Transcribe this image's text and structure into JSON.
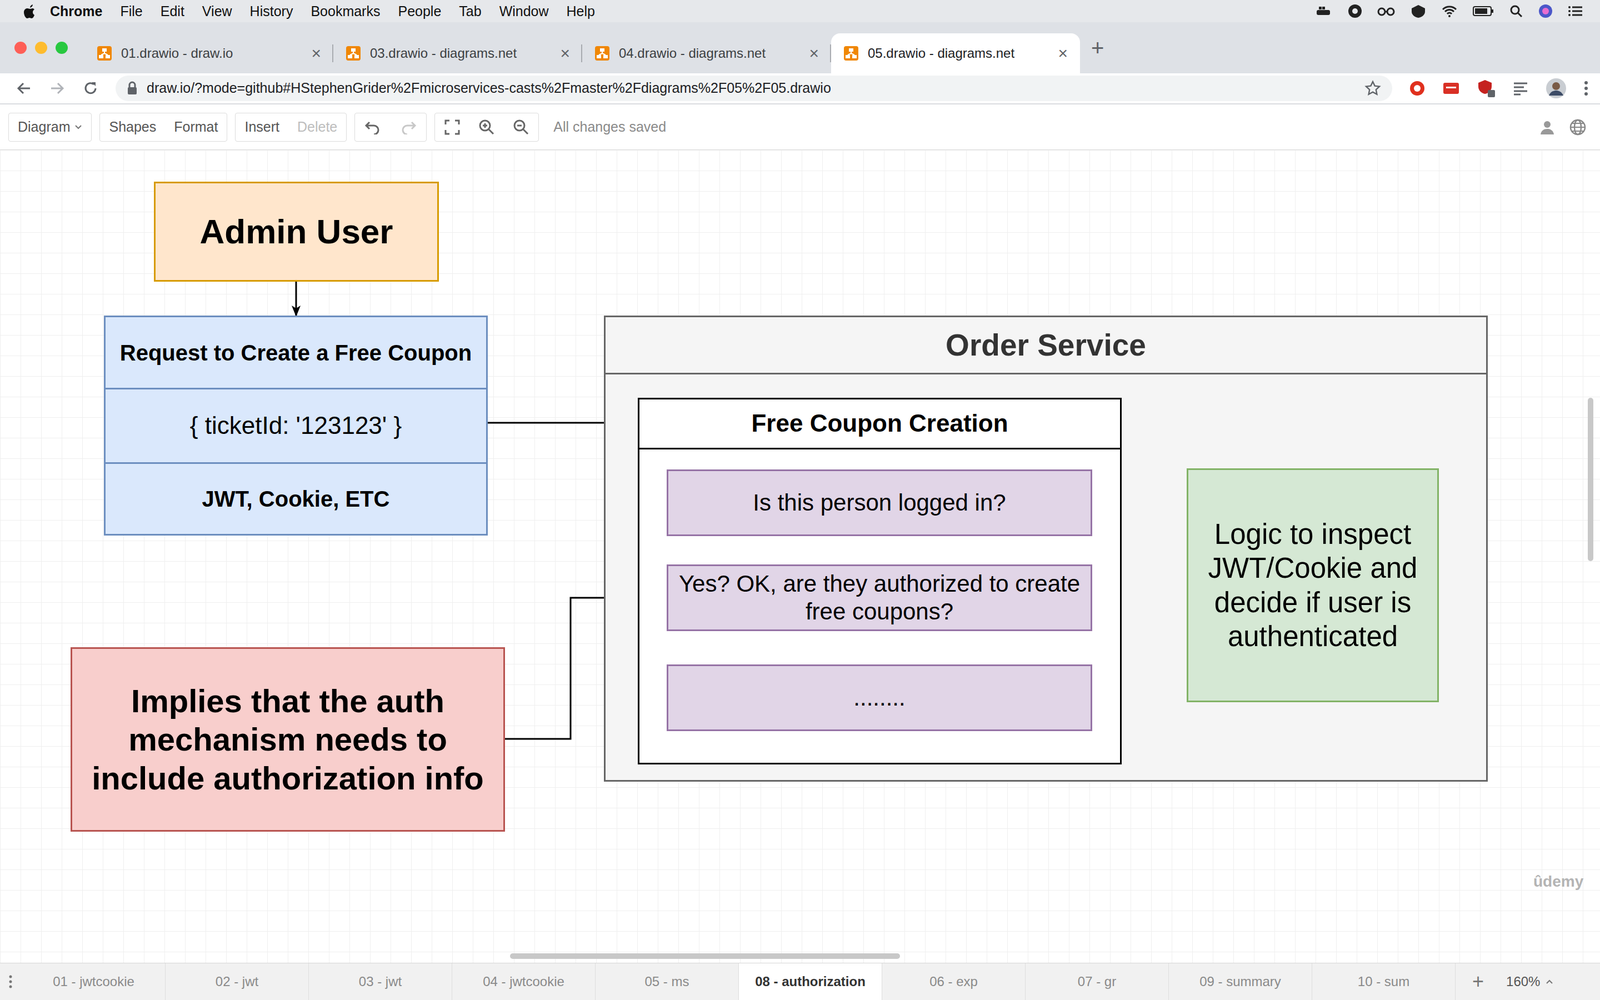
{
  "menubar": {
    "app": "Chrome",
    "items": [
      "File",
      "Edit",
      "View",
      "History",
      "Bookmarks",
      "People",
      "Tab",
      "Window",
      "Help"
    ]
  },
  "browser_tabs": [
    {
      "label": "01.drawio - draw.io",
      "close": "×",
      "selected": false
    },
    {
      "label": "03.drawio - diagrams.net",
      "close": "×",
      "selected": false
    },
    {
      "label": "04.drawio - diagrams.net",
      "close": "×",
      "selected": false
    },
    {
      "label": "05.drawio - diagrams.net",
      "close": "×",
      "selected": true
    }
  ],
  "new_tab": "+",
  "address": {
    "url": "draw.io/?mode=github#HStephenGrider%2Fmicroservices-casts%2Fmaster%2Fdiagrams%2F05%2F05.drawio"
  },
  "toolbar": {
    "groups": [
      [
        {
          "label": "Diagram",
          "kind": "dropdown",
          "disabled": false
        }
      ],
      [
        {
          "label": "Shapes",
          "kind": "button",
          "disabled": false
        },
        {
          "label": "Format",
          "kind": "button",
          "disabled": false
        }
      ],
      [
        {
          "label": "Insert",
          "kind": "button",
          "disabled": false
        },
        {
          "label": "Delete",
          "kind": "button",
          "disabled": true
        }
      ]
    ],
    "history_buttons": [
      {
        "kind": "undo",
        "disabled": false
      },
      {
        "kind": "redo",
        "disabled": true
      }
    ],
    "status": "All changes saved"
  },
  "diagram": {
    "admin_user": "Admin User",
    "request": {
      "title": "Request to Create a Free Coupon",
      "body": "{ ticketId: '123123' }",
      "auth": "JWT, Cookie, ETC"
    },
    "order_service": {
      "title": "Order Service",
      "free_coupon_creation": {
        "title": "Free Coupon Creation",
        "steps": [
          "Is this person logged in?",
          "Yes? OK, are they authorized to create free coupons?",
          "........"
        ]
      }
    },
    "logic_note": "Logic to inspect JWT/Cookie and decide if user is authenticated",
    "implication_note": "Implies that the auth mechanism needs to include authorization info"
  },
  "watermark": "ûdemy",
  "page_tabs": [
    {
      "label": "01 - jwtcookie",
      "selected": false
    },
    {
      "label": "02 - jwt",
      "selected": false
    },
    {
      "label": "03 - jwt",
      "selected": false
    },
    {
      "label": "04 - jwtcookie",
      "selected": false
    },
    {
      "label": "05 - ms",
      "selected": false
    },
    {
      "label": "08 - authorization",
      "selected": true
    },
    {
      "label": "06 - exp",
      "selected": false
    },
    {
      "label": "07 - gr",
      "selected": false
    },
    {
      "label": "09 - summary",
      "selected": false
    },
    {
      "label": "10 - sum",
      "selected": false
    }
  ],
  "add_page": "+",
  "zoom": "160%"
}
